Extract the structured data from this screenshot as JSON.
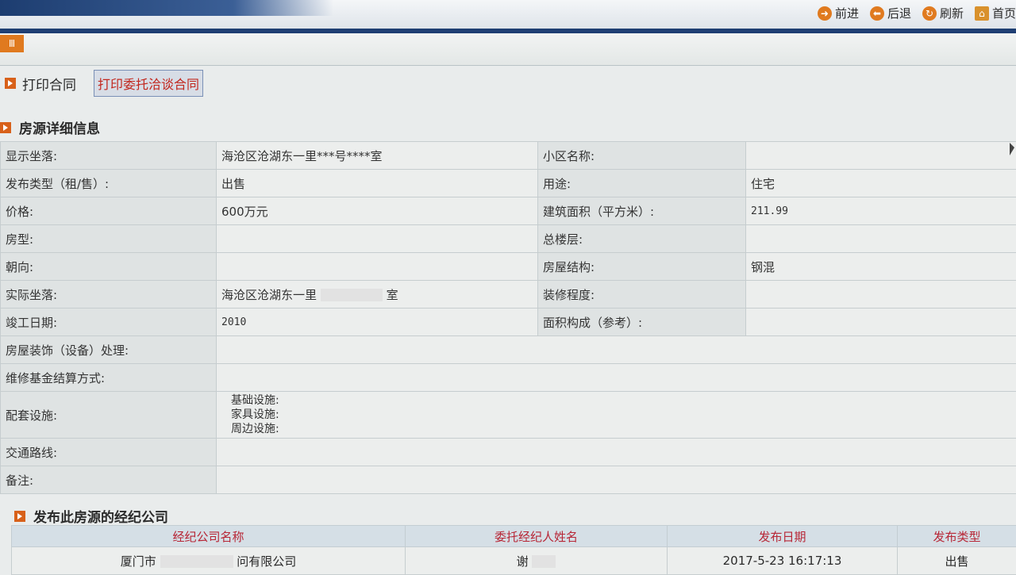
{
  "nav": {
    "forward": "前进",
    "back": "后退",
    "refresh": "刷新",
    "home": "首页"
  },
  "subbar": {
    "tab_icon_text": "Ⅲ"
  },
  "actions": {
    "print_contract": "打印合同",
    "print_entrust": "打印委托洽谈合同"
  },
  "detail": {
    "heading": "房源详细信息",
    "rows": [
      {
        "l1": "显示坐落:",
        "v1": "海沧区沧湖东一里***号****室",
        "l2": "小区名称:",
        "v2": ""
      },
      {
        "l1": "发布类型（租/售）:",
        "v1": "出售",
        "l2": "用途:",
        "v2": "住宅"
      },
      {
        "l1": "价格:",
        "v1": "600万元",
        "l2": "建筑面积（平方米）:",
        "v2": "211.99"
      },
      {
        "l1": "房型:",
        "v1": "",
        "l2": "总楼层:",
        "v2": ""
      },
      {
        "l1": "朝向:",
        "v1": "",
        "l2": "房屋结构:",
        "v2": "钢混"
      },
      {
        "l1": "实际坐落:",
        "v1": "海沧区沧湖东一里",
        "v1b": "室",
        "l2": "装修程度:",
        "v2": ""
      },
      {
        "l1": "竣工日期:",
        "v1": "2010",
        "l2": "面积构成（参考）:",
        "v2": ""
      }
    ],
    "decoration_label": "房屋装饰（设备）处理:",
    "fund_label": "维修基金结算方式:",
    "facilities_label": "配套设施:",
    "facilities": [
      "基础设施:",
      "家具设施:",
      "周边设施:"
    ],
    "traffic_label": "交通路线:",
    "remark_label": "备注:"
  },
  "company": {
    "heading": "发布此房源的经纪公司",
    "columns": [
      "经纪公司名称",
      "委托经纪人姓名",
      "发布日期",
      "发布类型"
    ],
    "row": {
      "name_prefix": "厦门市",
      "name_suffix": "问有限公司",
      "agent": "谢",
      "date": "2017-5-23 16:17:13",
      "type": "出售"
    }
  }
}
